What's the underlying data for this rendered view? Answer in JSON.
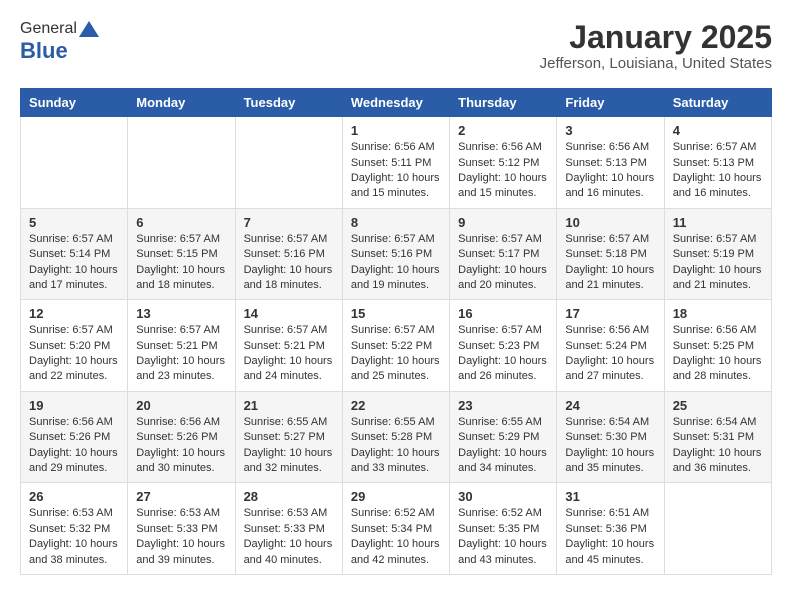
{
  "logo": {
    "general": "General",
    "blue": "Blue"
  },
  "title": "January 2025",
  "location": "Jefferson, Louisiana, United States",
  "days_header": [
    "Sunday",
    "Monday",
    "Tuesday",
    "Wednesday",
    "Thursday",
    "Friday",
    "Saturday"
  ],
  "weeks": [
    [
      {
        "day": "",
        "content": ""
      },
      {
        "day": "",
        "content": ""
      },
      {
        "day": "",
        "content": ""
      },
      {
        "day": "1",
        "content": "Sunrise: 6:56 AM\nSunset: 5:11 PM\nDaylight: 10 hours and 15 minutes."
      },
      {
        "day": "2",
        "content": "Sunrise: 6:56 AM\nSunset: 5:12 PM\nDaylight: 10 hours and 15 minutes."
      },
      {
        "day": "3",
        "content": "Sunrise: 6:56 AM\nSunset: 5:13 PM\nDaylight: 10 hours and 16 minutes."
      },
      {
        "day": "4",
        "content": "Sunrise: 6:57 AM\nSunset: 5:13 PM\nDaylight: 10 hours and 16 minutes."
      }
    ],
    [
      {
        "day": "5",
        "content": "Sunrise: 6:57 AM\nSunset: 5:14 PM\nDaylight: 10 hours and 17 minutes."
      },
      {
        "day": "6",
        "content": "Sunrise: 6:57 AM\nSunset: 5:15 PM\nDaylight: 10 hours and 18 minutes."
      },
      {
        "day": "7",
        "content": "Sunrise: 6:57 AM\nSunset: 5:16 PM\nDaylight: 10 hours and 18 minutes."
      },
      {
        "day": "8",
        "content": "Sunrise: 6:57 AM\nSunset: 5:16 PM\nDaylight: 10 hours and 19 minutes."
      },
      {
        "day": "9",
        "content": "Sunrise: 6:57 AM\nSunset: 5:17 PM\nDaylight: 10 hours and 20 minutes."
      },
      {
        "day": "10",
        "content": "Sunrise: 6:57 AM\nSunset: 5:18 PM\nDaylight: 10 hours and 21 minutes."
      },
      {
        "day": "11",
        "content": "Sunrise: 6:57 AM\nSunset: 5:19 PM\nDaylight: 10 hours and 21 minutes."
      }
    ],
    [
      {
        "day": "12",
        "content": "Sunrise: 6:57 AM\nSunset: 5:20 PM\nDaylight: 10 hours and 22 minutes."
      },
      {
        "day": "13",
        "content": "Sunrise: 6:57 AM\nSunset: 5:21 PM\nDaylight: 10 hours and 23 minutes."
      },
      {
        "day": "14",
        "content": "Sunrise: 6:57 AM\nSunset: 5:21 PM\nDaylight: 10 hours and 24 minutes."
      },
      {
        "day": "15",
        "content": "Sunrise: 6:57 AM\nSunset: 5:22 PM\nDaylight: 10 hours and 25 minutes."
      },
      {
        "day": "16",
        "content": "Sunrise: 6:57 AM\nSunset: 5:23 PM\nDaylight: 10 hours and 26 minutes."
      },
      {
        "day": "17",
        "content": "Sunrise: 6:56 AM\nSunset: 5:24 PM\nDaylight: 10 hours and 27 minutes."
      },
      {
        "day": "18",
        "content": "Sunrise: 6:56 AM\nSunset: 5:25 PM\nDaylight: 10 hours and 28 minutes."
      }
    ],
    [
      {
        "day": "19",
        "content": "Sunrise: 6:56 AM\nSunset: 5:26 PM\nDaylight: 10 hours and 29 minutes."
      },
      {
        "day": "20",
        "content": "Sunrise: 6:56 AM\nSunset: 5:26 PM\nDaylight: 10 hours and 30 minutes."
      },
      {
        "day": "21",
        "content": "Sunrise: 6:55 AM\nSunset: 5:27 PM\nDaylight: 10 hours and 32 minutes."
      },
      {
        "day": "22",
        "content": "Sunrise: 6:55 AM\nSunset: 5:28 PM\nDaylight: 10 hours and 33 minutes."
      },
      {
        "day": "23",
        "content": "Sunrise: 6:55 AM\nSunset: 5:29 PM\nDaylight: 10 hours and 34 minutes."
      },
      {
        "day": "24",
        "content": "Sunrise: 6:54 AM\nSunset: 5:30 PM\nDaylight: 10 hours and 35 minutes."
      },
      {
        "day": "25",
        "content": "Sunrise: 6:54 AM\nSunset: 5:31 PM\nDaylight: 10 hours and 36 minutes."
      }
    ],
    [
      {
        "day": "26",
        "content": "Sunrise: 6:53 AM\nSunset: 5:32 PM\nDaylight: 10 hours and 38 minutes."
      },
      {
        "day": "27",
        "content": "Sunrise: 6:53 AM\nSunset: 5:33 PM\nDaylight: 10 hours and 39 minutes."
      },
      {
        "day": "28",
        "content": "Sunrise: 6:53 AM\nSunset: 5:33 PM\nDaylight: 10 hours and 40 minutes."
      },
      {
        "day": "29",
        "content": "Sunrise: 6:52 AM\nSunset: 5:34 PM\nDaylight: 10 hours and 42 minutes."
      },
      {
        "day": "30",
        "content": "Sunrise: 6:52 AM\nSunset: 5:35 PM\nDaylight: 10 hours and 43 minutes."
      },
      {
        "day": "31",
        "content": "Sunrise: 6:51 AM\nSunset: 5:36 PM\nDaylight: 10 hours and 45 minutes."
      },
      {
        "day": "",
        "content": ""
      }
    ]
  ]
}
